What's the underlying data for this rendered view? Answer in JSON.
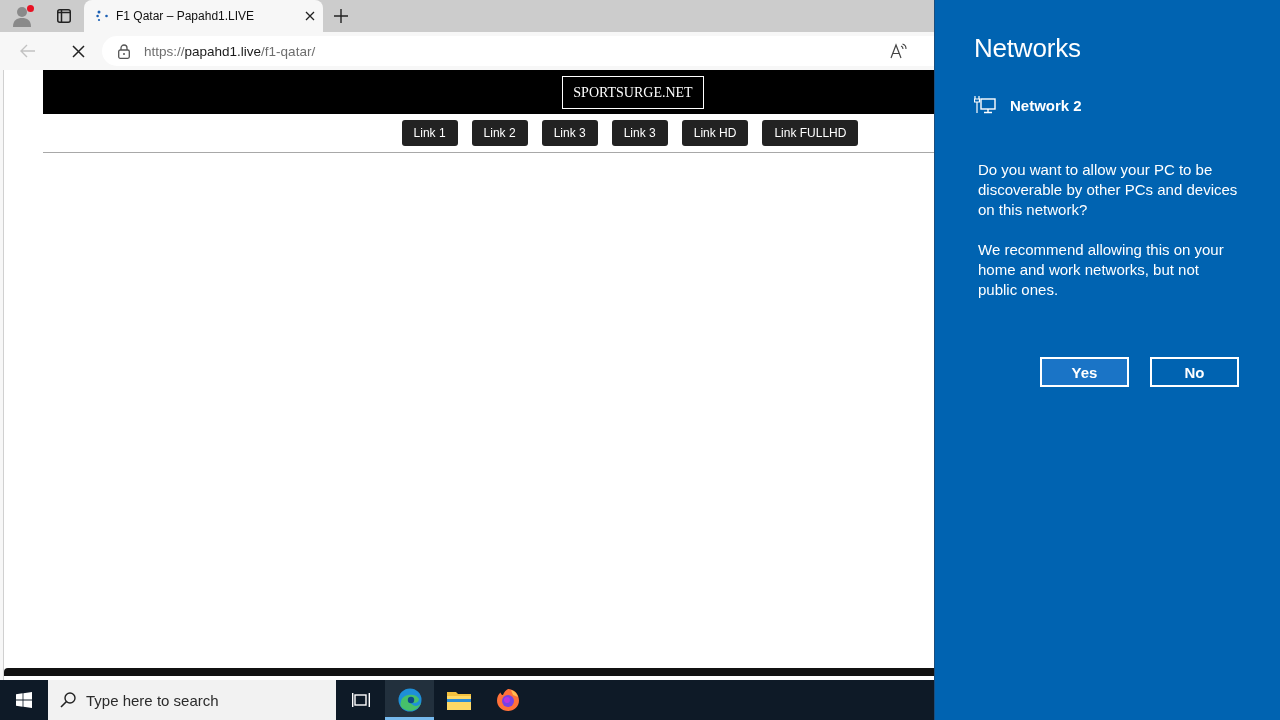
{
  "browser": {
    "profile": {
      "notification": true
    },
    "tabs": [
      {
        "title": "F1 Qatar – Papahd1.LIVE",
        "selected": true,
        "loading": true
      }
    ],
    "toolbar": {
      "back_disabled": true,
      "loading": true,
      "url": "https://**papahd1.live**/f1-qatar/"
    }
  },
  "site": {
    "brand": "SPORTSURGE.NET",
    "links": [
      "Link 1",
      "Link 2",
      "Link 3",
      "Link 3",
      "Link HD",
      "Link FULLHD"
    ]
  },
  "taskbar": {
    "search": {
      "placeholder": "Type here to search"
    },
    "apps": [
      {
        "kind": "task-view",
        "active": false
      },
      {
        "kind": "edge",
        "active": true
      },
      {
        "kind": "explorer",
        "active": false
      },
      {
        "kind": "firefox",
        "active": false
      }
    ]
  },
  "networks_panel": {
    "title": "Networks",
    "network": {
      "name": "Network 2"
    },
    "paragraphs": [
      "Do you want to allow your PC to be discoverable by other PCs and devices on this network?",
      "We recommend allowing this on your home and work networks, but not public ones."
    ],
    "buttons": [
      {
        "label": "Yes",
        "default": true
      },
      {
        "label": "No",
        "default": false
      }
    ]
  }
}
